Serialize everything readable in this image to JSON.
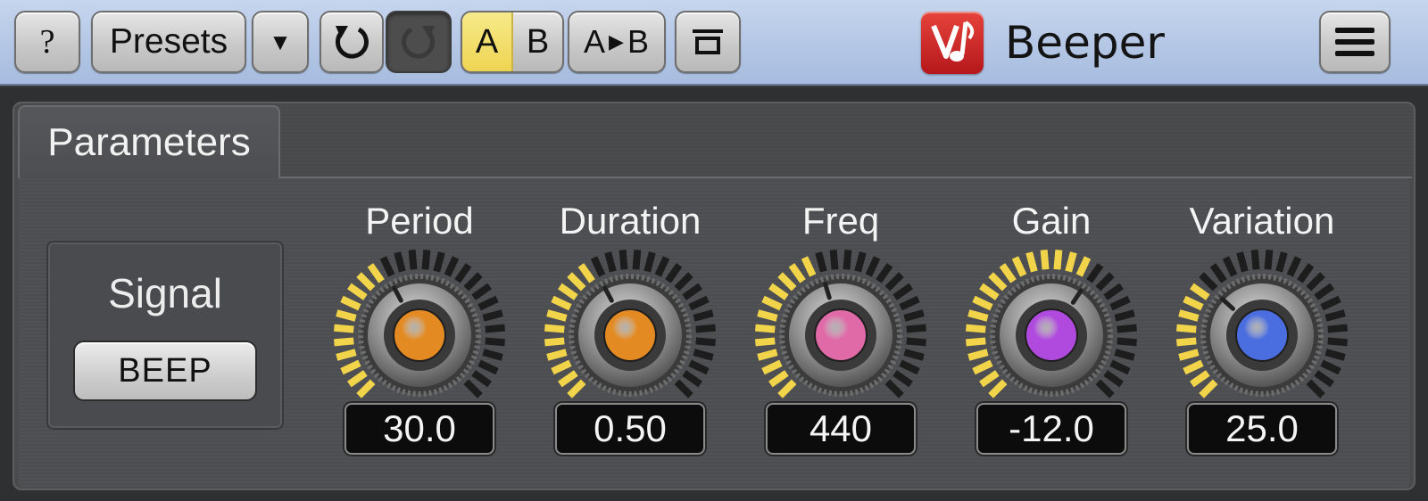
{
  "toolbar": {
    "help_label": "?",
    "presets_label": "Presets",
    "dropdown_glyph": "▼",
    "undo_glyph": "↺",
    "redo_glyph": "↻",
    "ab": {
      "a_label": "A",
      "b_label": "B"
    },
    "copy": {
      "left": "A",
      "arrow": "▶",
      "right": "B"
    },
    "compare_icon": "bracket-icon",
    "menu_icon": "hamburger-icon"
  },
  "plugin": {
    "title": "Beeper"
  },
  "tabs": [
    {
      "label": "Parameters"
    }
  ],
  "signal": {
    "label": "Signal",
    "button_label": "BEEP"
  },
  "knobs": [
    {
      "name": "period",
      "label": "Period",
      "value": "30.0",
      "fraction": 0.4,
      "color": "#e48a22"
    },
    {
      "name": "duration",
      "label": "Duration",
      "value": "0.50",
      "fraction": 0.4,
      "color": "#e48a22"
    },
    {
      "name": "freq",
      "label": "Freq",
      "value": "440",
      "fraction": 0.44,
      "color": "#e06aa8"
    },
    {
      "name": "gain",
      "label": "Gain",
      "value": "-12.0",
      "fraction": 0.62,
      "color": "#b04adf"
    },
    {
      "name": "variation",
      "label": "Variation",
      "value": "25.0",
      "fraction": 0.33,
      "color": "#4a6de0"
    }
  ],
  "colors": {
    "toolbar_bg": "#b2c5e4",
    "ring_on": "#f2d44a",
    "ring_off": "#1d1d1d",
    "ab_active": "#eed452"
  }
}
